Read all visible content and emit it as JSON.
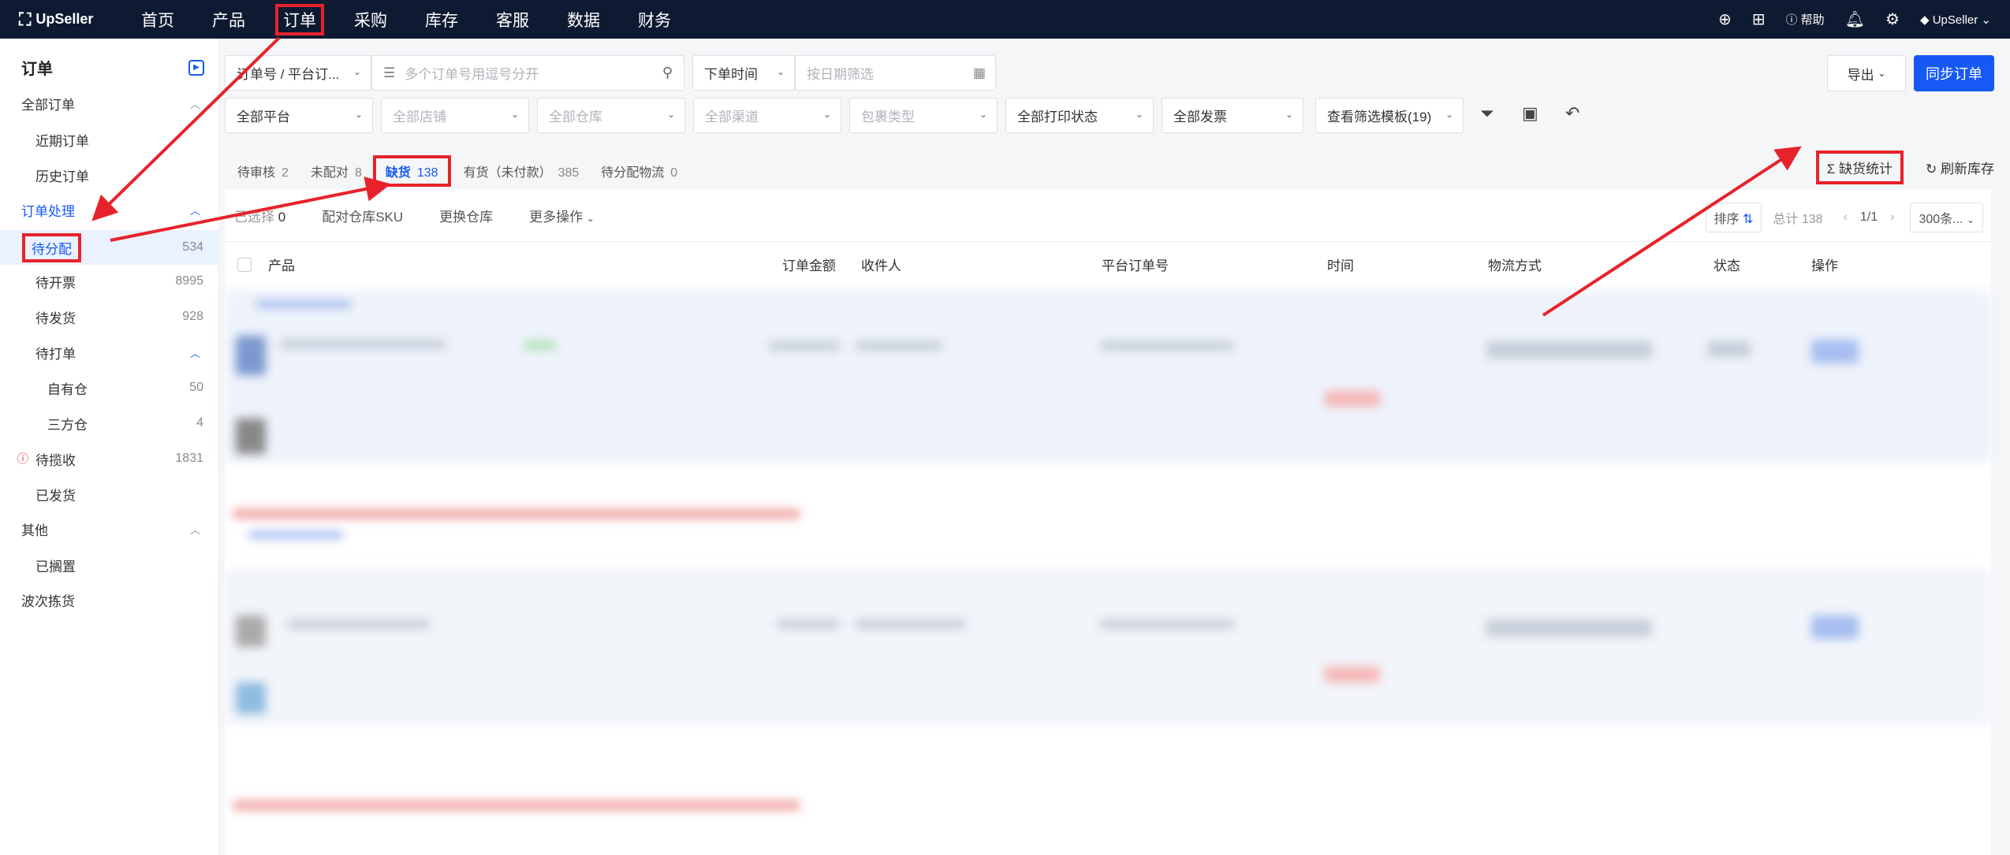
{
  "topbar": {
    "logo": "UpSeller",
    "nav": [
      "首页",
      "产品",
      "订单",
      "采购",
      "库存",
      "客服",
      "数据",
      "财务"
    ],
    "active_index": 2,
    "help": "帮助",
    "account": "UpSeller"
  },
  "sidebar": {
    "title": "订单",
    "items": [
      {
        "label": "全部订单",
        "type": "group"
      },
      {
        "label": "近期订单",
        "type": "item"
      },
      {
        "label": "历史订单",
        "type": "item"
      },
      {
        "label": "订单处理",
        "type": "group"
      },
      {
        "label": "待分配",
        "count": "534",
        "type": "item",
        "selected": true
      },
      {
        "label": "待开票",
        "count": "8995",
        "type": "item"
      },
      {
        "label": "待发货",
        "count": "928",
        "type": "item"
      },
      {
        "label": "待打单",
        "type": "subgroup"
      },
      {
        "label": "自有仓",
        "count": "50",
        "type": "sub"
      },
      {
        "label": "三方仓",
        "count": "4",
        "type": "sub"
      },
      {
        "label": "待揽收",
        "count": "1831",
        "type": "item"
      },
      {
        "label": "已发货",
        "type": "item"
      },
      {
        "label": "其他",
        "type": "group"
      },
      {
        "label": "已搁置",
        "type": "item"
      },
      {
        "label": "波次拣货",
        "type": "group-plain"
      }
    ]
  },
  "filters": {
    "order_type": "订单号 / 平台订...",
    "search_placeholder": "多个订单号用逗号分开",
    "time_type": "下单时间",
    "date_placeholder": "按日期筛选",
    "export": "导出",
    "sync": "同步订单",
    "row2": [
      "全部平台",
      "全部店铺",
      "全部仓库",
      "全部渠道",
      "包裹类型",
      "全部打印状态",
      "全部发票",
      "查看筛选模板(19)"
    ]
  },
  "tabs": [
    {
      "label": "待审核",
      "count": "2"
    },
    {
      "label": "未配对",
      "count": "8"
    },
    {
      "label": "缺货",
      "count": "138",
      "active": true
    },
    {
      "label": "有货（未付款）",
      "count": "385"
    },
    {
      "label": "待分配物流",
      "count": "0"
    }
  ],
  "tabs_right": {
    "shortage": "缺货统计",
    "refresh": "刷新库存"
  },
  "toolbar": {
    "selected": "已选择",
    "selected_count": "0",
    "match_sku": "配对仓库SKU",
    "change_wh": "更换仓库",
    "more": "更多操作",
    "sort": "排序",
    "total": "总计 138",
    "page": "1/1",
    "per_page": "300条..."
  },
  "table_headers": [
    "产品",
    "订单金额",
    "收件人",
    "平台订单号",
    "时间",
    "物流方式",
    "状态",
    "操作"
  ],
  "colors": {
    "accent": "#1659f5",
    "highlight": "#e8222b",
    "topbar": "#0e1a31"
  }
}
